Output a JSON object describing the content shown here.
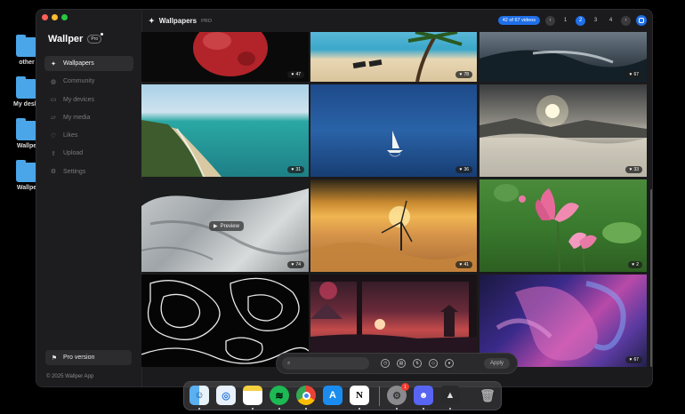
{
  "desktop": {
    "items": [
      {
        "label": "other"
      },
      {
        "label": "My deskt"
      },
      {
        "label": "Wallpe"
      },
      {
        "label": "Wallpe"
      }
    ]
  },
  "app": {
    "brand": "Wallper",
    "brand_badge": "Pro",
    "nav": [
      {
        "label": "Wallpapers",
        "icon": "sparkle-icon",
        "active": true
      },
      {
        "label": "Community",
        "icon": "globe-icon"
      },
      {
        "label": "My devices",
        "icon": "monitor-icon"
      },
      {
        "label": "My media",
        "icon": "folder-icon"
      },
      {
        "label": "Likes",
        "icon": "heart-icon"
      },
      {
        "label": "Upload",
        "icon": "upload-icon"
      },
      {
        "label": "Settings",
        "icon": "gear-icon"
      }
    ],
    "pro_version_label": "Pro version",
    "copyright": "© 2025 Wallper App"
  },
  "topbar": {
    "title": "Wallpapers",
    "title_tag": "PRO",
    "video_count": "42 of 67 videos",
    "pages": [
      "1",
      "2",
      "3",
      "4"
    ],
    "current_page": "2"
  },
  "grid": {
    "tiles": [
      {
        "name": "red-fruit",
        "likes": "47"
      },
      {
        "name": "palm-beach",
        "likes": "78"
      },
      {
        "name": "ocean-waves",
        "likes": "67"
      },
      {
        "name": "tropical-coast",
        "likes": "31"
      },
      {
        "name": "sailboat-sea",
        "likes": "36"
      },
      {
        "name": "sunrise-clouds",
        "likes": "33"
      },
      {
        "name": "aerial-snow",
        "likes": "74"
      },
      {
        "name": "wind-turbine",
        "likes": "41"
      },
      {
        "name": "lotus-flowers",
        "likes": "2"
      },
      {
        "name": "topographic-lines",
        "likes": ""
      },
      {
        "name": "sunset-temple",
        "likes": ""
      },
      {
        "name": "color-smoke",
        "likes": "67"
      }
    ],
    "preview_label": "Preview"
  },
  "filterbar": {
    "search_placeholder": "",
    "apply_label": "Apply"
  },
  "dock": {
    "apps": [
      "finder-icon",
      "safari-icon",
      "notes-icon",
      "spotify-icon",
      "chrome-icon",
      "app-store-icon",
      "notion-icon",
      "system-settings-icon",
      "discord-icon",
      "wallper-icon",
      "trash-icon"
    ],
    "settings_badge": "1"
  },
  "colors": {
    "accent": "#1f6fe8",
    "window_bg": "#1b1b1d"
  }
}
